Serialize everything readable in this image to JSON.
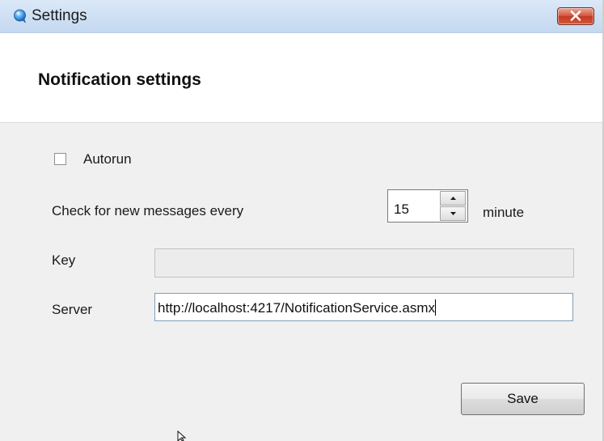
{
  "window": {
    "title": "Settings",
    "app_icon": "chat-bubble-icon",
    "close_icon": "close-icon",
    "colors": {
      "titlebar": "#cfe0f4",
      "close": "#c13a22",
      "body": "#f0f0f0"
    }
  },
  "header": {
    "title": "Notification settings"
  },
  "form": {
    "autorun": {
      "label": "Autorun",
      "checked": false
    },
    "check_interval": {
      "label": "Check for new messages every",
      "value": "15",
      "unit": "minute",
      "up_icon": "chevron-up-icon",
      "down_icon": "chevron-down-icon"
    },
    "key": {
      "label": "Key",
      "value": ""
    },
    "server": {
      "label": "Server",
      "value": "http://localhost:4217/NotificationService.asmx"
    },
    "save_label": "Save"
  },
  "pointer": {
    "icon": "mouse-cursor-icon"
  }
}
